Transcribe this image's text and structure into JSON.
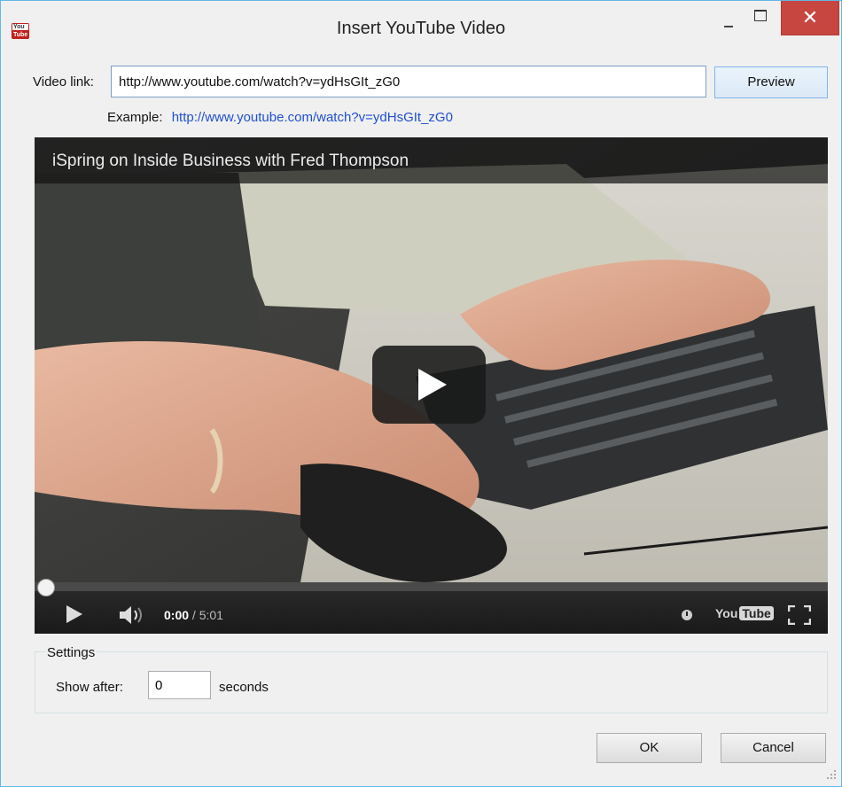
{
  "window": {
    "title": "Insert YouTube Video",
    "app_icon_top": "You",
    "app_icon_bottom": "Tube",
    "controls": {
      "minimize": "minimize-icon",
      "maximize": "maximize-icon",
      "close": "close-icon"
    },
    "close_color": "#c7463f"
  },
  "video_link": {
    "label": "Video link:",
    "value": "http://www.youtube.com/watch?v=ydHsGIt_zG0",
    "preview_label": "Preview"
  },
  "example": {
    "label": "Example:",
    "link": "http://www.youtube.com/watch?v=ydHsGIt_zG0",
    "link_color": "#1f4fd1"
  },
  "player": {
    "video_title": "iSpring on Inside Business with Fred Thompson",
    "current_time": "0:00",
    "duration": "/ 5:01",
    "progress": 0,
    "logo_you": "You",
    "logo_tube": "Tube",
    "icons": [
      "play-icon",
      "volume-icon",
      "watch-later-icon",
      "fullscreen-icon"
    ]
  },
  "settings": {
    "legend": "Settings",
    "show_after_label": "Show after:",
    "show_after_value": "0",
    "seconds_label": "seconds"
  },
  "buttons": {
    "ok": "OK",
    "cancel": "Cancel"
  }
}
